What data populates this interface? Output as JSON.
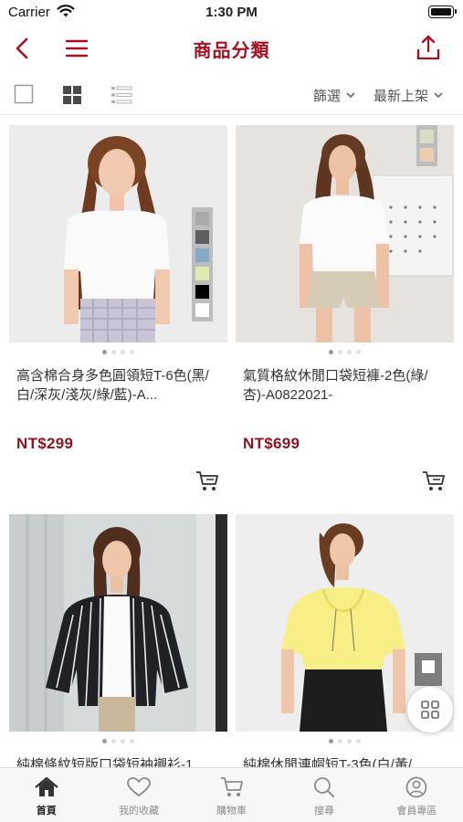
{
  "status_bar": {
    "carrier": "Carrier",
    "time": "1:30 PM"
  },
  "navbar": {
    "title": "商品分類"
  },
  "toolbar": {
    "filter_label": "篩選",
    "sort_label": "最新上架"
  },
  "colors": {
    "accent": "#a8101f",
    "price": "#8e1521"
  },
  "products": [
    {
      "name": "高含棉合身多色圓領短T-6色(黑/白/深灰/淺灰/綠/藍)-A...",
      "price": "NT$299",
      "swatches": [
        "#a9a9a9",
        "#5e5e62",
        "#88a8c8",
        "#d9edb0",
        "#000000",
        "#ffffff"
      ]
    },
    {
      "name": "氣質格紋休閒口袋短褲-2色(綠/杏)-A0822021-",
      "price": "NT$699",
      "swatches": [
        "#dcdcc6",
        "#eccdb0"
      ]
    },
    {
      "name": "純棉條紋短版口袋短袖襯衫-1",
      "price": "",
      "swatches": []
    },
    {
      "name": "純棉休閒連帽短T-3色(白/黃/",
      "price": "",
      "swatches": [
        "#ffffff"
      ]
    }
  ],
  "tabs": [
    {
      "label": "首頁",
      "icon": "home-icon",
      "active": true
    },
    {
      "label": "我的收藏",
      "icon": "heart-icon",
      "active": false
    },
    {
      "label": "購物車",
      "icon": "cart-icon",
      "active": false
    },
    {
      "label": "搜尋",
      "icon": "search-icon",
      "active": false
    },
    {
      "label": "會員專區",
      "icon": "user-icon",
      "active": false
    }
  ]
}
